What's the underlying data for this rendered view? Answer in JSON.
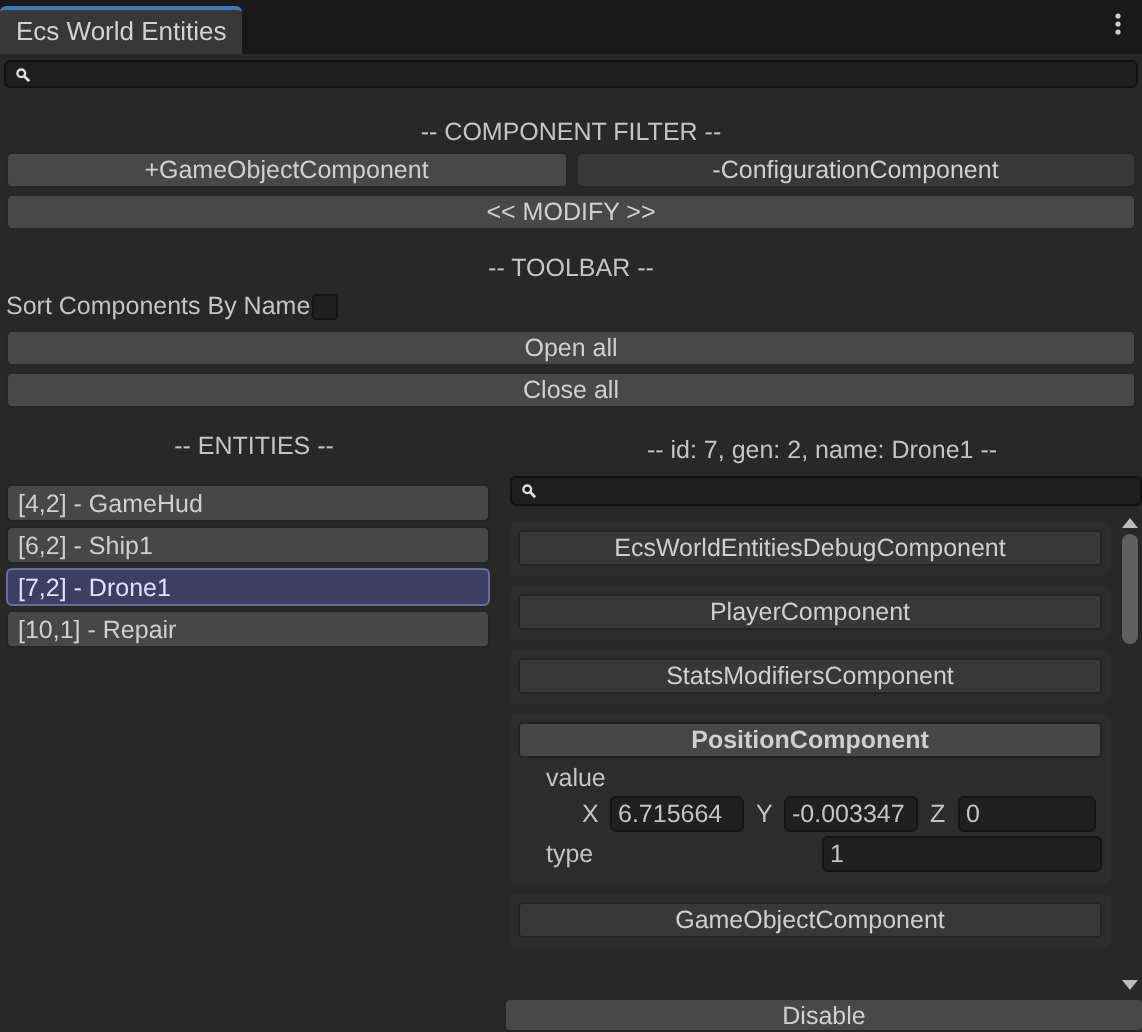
{
  "window": {
    "tab": "Ecs World Entities"
  },
  "component_filter": {
    "title": "-- COMPONENT FILTER --",
    "buttons": [
      "+GameObjectComponent",
      "-ConfigurationComponent"
    ],
    "modify": "<< MODIFY >>"
  },
  "toolbar": {
    "title": "-- TOOLBAR --",
    "sort_label": "Sort Components By Name",
    "sort_checked": false,
    "buttons": [
      "Open all",
      "Close all"
    ]
  },
  "entities": {
    "title": "-- ENTITIES --",
    "items": [
      {
        "label": "[4,2] - GameHud",
        "selected": false
      },
      {
        "label": "[6,2] - Ship1",
        "selected": false
      },
      {
        "label": "[7,2] - Drone1",
        "selected": true
      },
      {
        "label": "[10,1] - Repair",
        "selected": false
      }
    ]
  },
  "inspector": {
    "title": "-- id: 7, gen: 2, name: Drone1 --",
    "components": [
      {
        "name": "EcsWorldEntitiesDebugComponent",
        "expanded": false
      },
      {
        "name": "PlayerComponent",
        "expanded": false
      },
      {
        "name": "StatsModifiersComponent",
        "expanded": false
      },
      {
        "name": "PositionComponent",
        "expanded": true,
        "fields": [
          {
            "kind": "vector",
            "label": "value",
            "axes": [
              {
                "axis": "X",
                "value": "6.715664"
              },
              {
                "axis": "Y",
                "value": "-0.003347"
              },
              {
                "axis": "Z",
                "value": "0"
              }
            ]
          },
          {
            "kind": "number",
            "label": "type",
            "value": "1"
          }
        ]
      },
      {
        "name": "GameObjectComponent",
        "expanded": false
      }
    ],
    "button": "Disable"
  }
}
